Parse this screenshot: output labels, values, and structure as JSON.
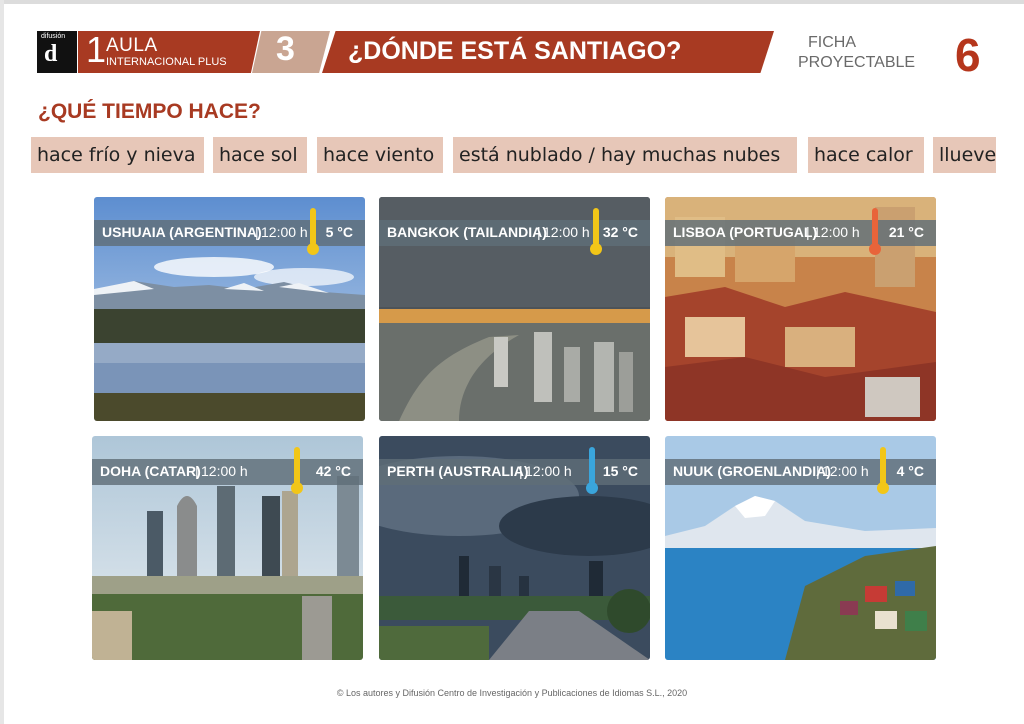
{
  "header": {
    "logo_small": "difusión",
    "logo_big": "d",
    "aula_level": "1",
    "aula_title": "AULA",
    "aula_subtitle": "INTERNACIONAL PLUS",
    "unit_number": "3",
    "unit_title": "¿DÓNDE ESTÁ SANTIAGO?",
    "ficha_line1": "FICHA",
    "ficha_line2": "PROYECTABLE",
    "ficha_number": "6"
  },
  "section_title": "¿QUÉ TIEMPO HACE?",
  "vocabulary": [
    "hace frío y nieva",
    "hace sol",
    "hace viento",
    "está nublado / hay muchas nubes",
    "hace calor",
    "llueve"
  ],
  "photos": [
    {
      "place": "USHUAIA (ARGENTINA)",
      "time": "12:00 h",
      "temperature": "5 °C",
      "thermo_color": "#f2c618"
    },
    {
      "place": "BANGKOK (TAILANDIA)",
      "time": "12:00 h",
      "temperature": "32 °C",
      "thermo_color": "#f2c618"
    },
    {
      "place": "LISBOA (PORTUGAL)",
      "time": "12:00 h",
      "temperature": "21 °C",
      "thermo_color": "#e8643a"
    },
    {
      "place": "DOHA (CATAR)",
      "time": "12:00 h",
      "temperature": "42 °C",
      "thermo_color": "#f2c618"
    },
    {
      "place": "PERTH (AUSTRALIA)",
      "time": "12:00 h",
      "temperature": "15 °C",
      "thermo_color": "#3aa5dc"
    },
    {
      "place": "NUUK (GROENLANDIA)",
      "time": "12:00 h",
      "temperature": "4 °C",
      "thermo_color": "#f2c618"
    }
  ],
  "footer": "© Los autores y Difusión Centro de Investigación y Publicaciones de Idiomas S.L., 2020",
  "colors": {
    "accent": "#a83a22",
    "chip": "#e7c7b8",
    "number": "#b5361c"
  }
}
